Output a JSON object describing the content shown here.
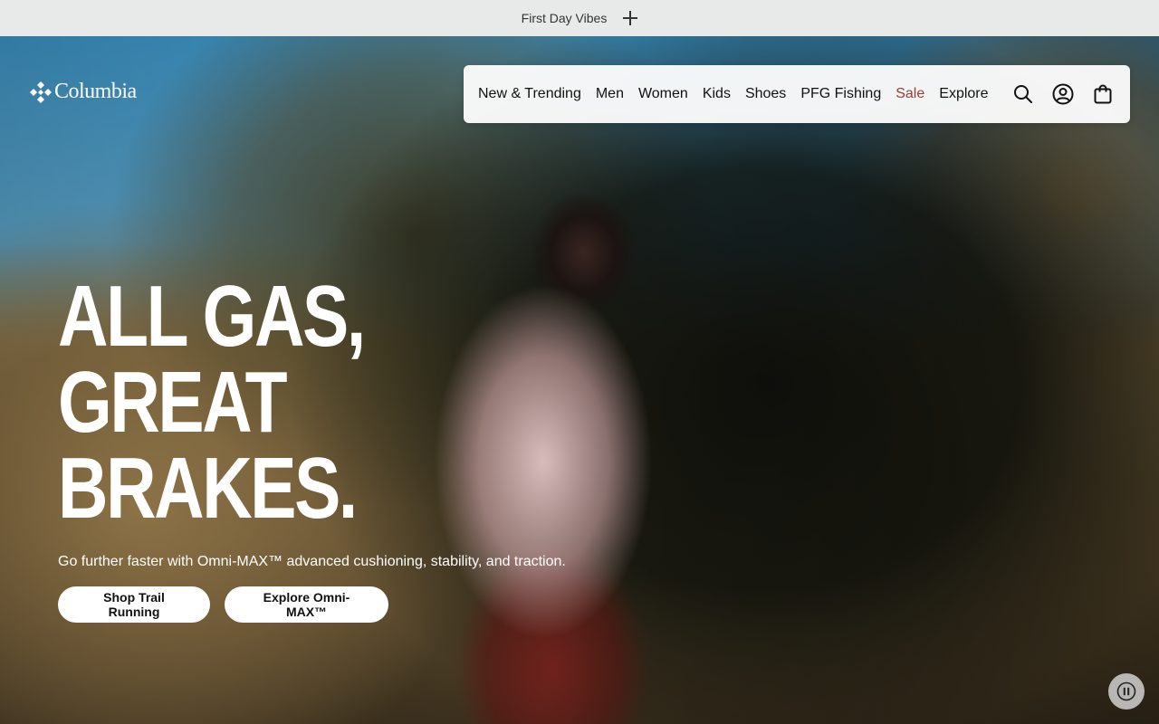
{
  "promo": {
    "text": "First Day Vibes"
  },
  "brand": {
    "name": "Columbia"
  },
  "nav": {
    "items": [
      {
        "label": "New & Trending"
      },
      {
        "label": "Men"
      },
      {
        "label": "Women"
      },
      {
        "label": "Kids"
      },
      {
        "label": "Shoes"
      },
      {
        "label": "PFG Fishing"
      },
      {
        "label": "Sale"
      },
      {
        "label": "Explore"
      }
    ],
    "icons": [
      "search-icon",
      "account-icon",
      "shopping-bag-icon"
    ]
  },
  "hero": {
    "headline": [
      "ALL GAS,",
      "GREAT",
      "BRAKES."
    ],
    "subtitle": "Go further faster with Omni-MAX™ advanced cushioning, stability, and traction.",
    "cta_primary": "Shop Trail Running",
    "cta_secondary": "Explore Omni-MAX™",
    "pause_icon": "pause-icon"
  },
  "colors": {
    "sale": "#9a3d2f",
    "promo_bg": "#e8e9e9",
    "button_bg": "#ffffff"
  }
}
